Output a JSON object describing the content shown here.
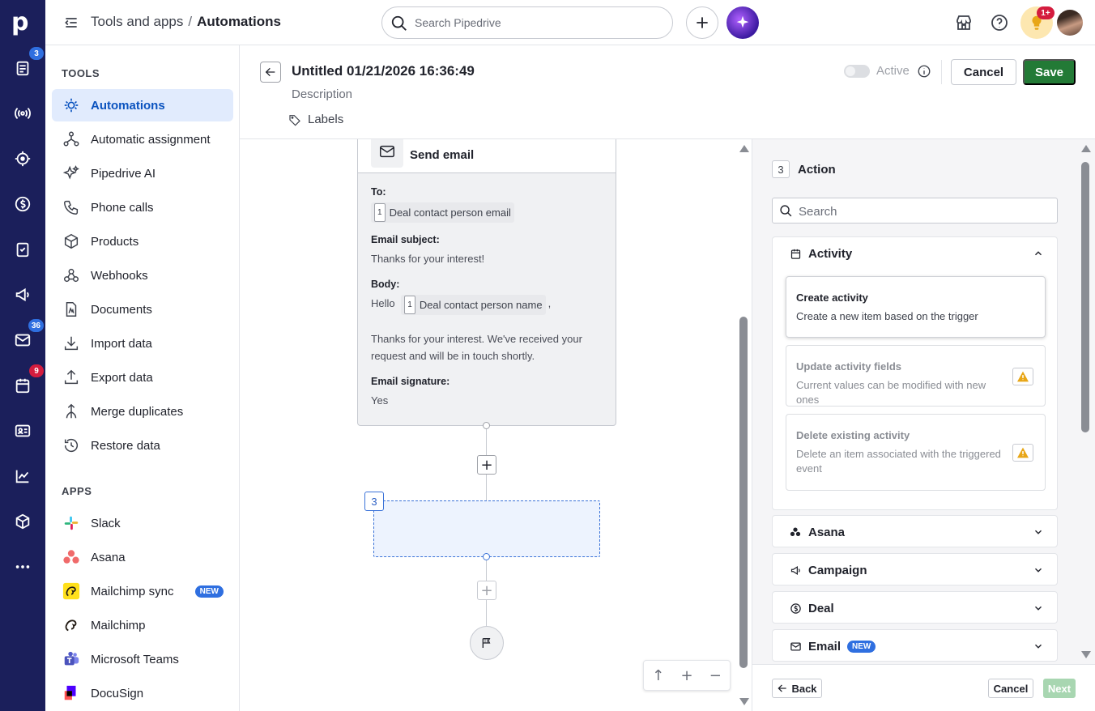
{
  "header": {
    "breadcrumb_parent": "Tools and apps",
    "breadcrumb_sep": "/",
    "breadcrumb_current": "Automations",
    "search_placeholder": "Search Pipedrive",
    "bulb_badge": "1+"
  },
  "rail": {
    "logo": "p",
    "badges": {
      "leads": "3",
      "mail": "36",
      "calendar": "9"
    }
  },
  "sidebar": {
    "tools_title": "TOOLS",
    "tools": [
      {
        "label": "Automations",
        "icon": "automations-icon",
        "active": true
      },
      {
        "label": "Automatic assignment",
        "icon": "assignment-icon"
      },
      {
        "label": "Pipedrive AI",
        "icon": "sparkle-icon"
      },
      {
        "label": "Phone calls",
        "icon": "phone-icon"
      },
      {
        "label": "Products",
        "icon": "box-icon"
      },
      {
        "label": "Webhooks",
        "icon": "webhook-icon"
      },
      {
        "label": "Documents",
        "icon": "document-icon"
      },
      {
        "label": "Import data",
        "icon": "import-icon"
      },
      {
        "label": "Export data",
        "icon": "export-icon"
      },
      {
        "label": "Merge duplicates",
        "icon": "merge-icon"
      },
      {
        "label": "Restore data",
        "icon": "restore-icon"
      }
    ],
    "apps_title": "APPS",
    "apps": [
      {
        "label": "Slack",
        "icon": "slack-icon"
      },
      {
        "label": "Asana",
        "icon": "asana-icon"
      },
      {
        "label": "Mailchimp sync",
        "icon": "mailchimp-icon",
        "badge": "NEW"
      },
      {
        "label": "Mailchimp",
        "icon": "mailchimp-icon"
      },
      {
        "label": "Microsoft Teams",
        "icon": "teams-icon"
      },
      {
        "label": "DocuSign",
        "icon": "docusign-icon"
      }
    ]
  },
  "automation": {
    "title": "Untitled 01/21/2026 16:36:49",
    "description": "Description",
    "labels": "Labels",
    "active_label": "Active",
    "cancel_label": "Cancel",
    "save_label": "Save"
  },
  "email_step": {
    "title": "Send email",
    "to_label": "To:",
    "to_chip_num": "1",
    "to_chip": "Deal contact person email",
    "subject_label": "Email subject:",
    "subject": "Thanks for your interest!",
    "body_label": "Body:",
    "body_hello": "Hello",
    "body_chip_num": "1",
    "body_chip": "Deal contact person name",
    "body_comma": ",",
    "body_text": "Thanks for your interest. We've received your request and will be in touch shortly.",
    "signature_label": "Email signature:",
    "signature": "Yes"
  },
  "canvas": {
    "step_number": "3",
    "zoom_up": "↑",
    "zoom_in": "+",
    "zoom_out": "−"
  },
  "panel": {
    "step_number": "3",
    "title": "Action",
    "search_placeholder": "Search",
    "groups": [
      {
        "label": "Activity",
        "expanded": true
      },
      {
        "label": "Asana"
      },
      {
        "label": "Campaign"
      },
      {
        "label": "Deal"
      },
      {
        "label": "Email",
        "badge": "NEW"
      }
    ],
    "activity_items": [
      {
        "title": "Create activity",
        "desc": "Create a new item based on the trigger"
      },
      {
        "title": "Update activity fields",
        "desc": "Current values can be modified with new ones"
      },
      {
        "title": "Delete existing activity",
        "desc": "Delete an item associated with the triggered event"
      }
    ],
    "back_label": "Back",
    "cancel_label": "Cancel",
    "next_label": "Next"
  },
  "colors": {
    "rail": "#1b1f5b",
    "accent": "#0b53bf",
    "save": "#237a36",
    "badge_blue": "#2f6fe0",
    "badge_red": "#d41c3e"
  }
}
